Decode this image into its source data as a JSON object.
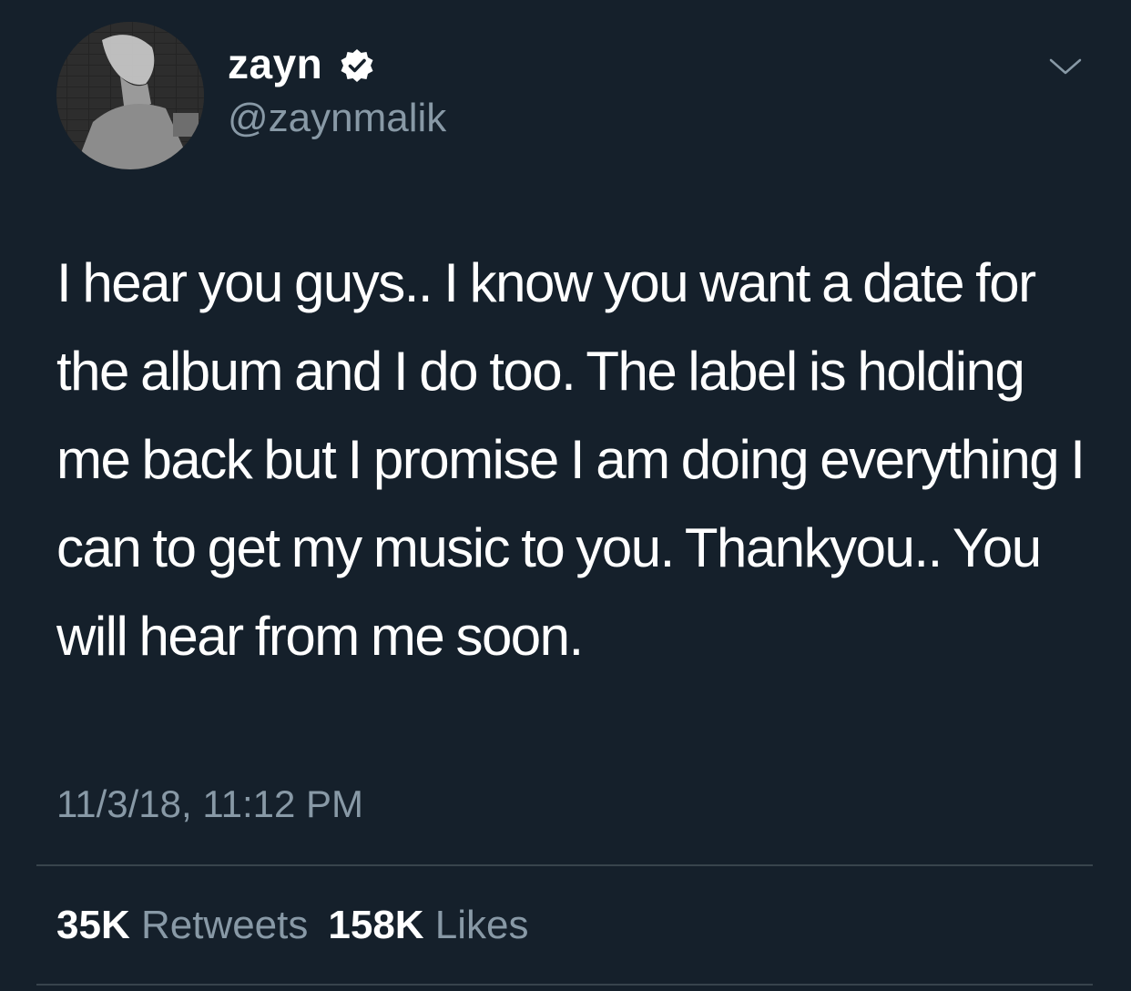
{
  "tweet": {
    "author": {
      "display_name": "zayn",
      "handle": "@zaynmalik",
      "verified_icon": "verified-badge-icon",
      "avatar_icon": "profile-avatar"
    },
    "menu_icon": "chevron-down-icon",
    "text": "I hear you guys.. I know you want a date for the album and I do too. The label is holding me back but I promise I am doing everything I can to get my music to you. Thankyou.. You will hear from me soon.",
    "timestamp": "11/3/18, 11:12 PM",
    "stats": {
      "retweets_count": "35K",
      "retweets_label": "Retweets",
      "likes_count": "158K",
      "likes_label": "Likes"
    }
  },
  "colors": {
    "background": "#15202b",
    "primary_text": "#ffffff",
    "secondary_text": "#8899a6",
    "divider": "#38444d",
    "verified_badge": "#ffffff"
  }
}
